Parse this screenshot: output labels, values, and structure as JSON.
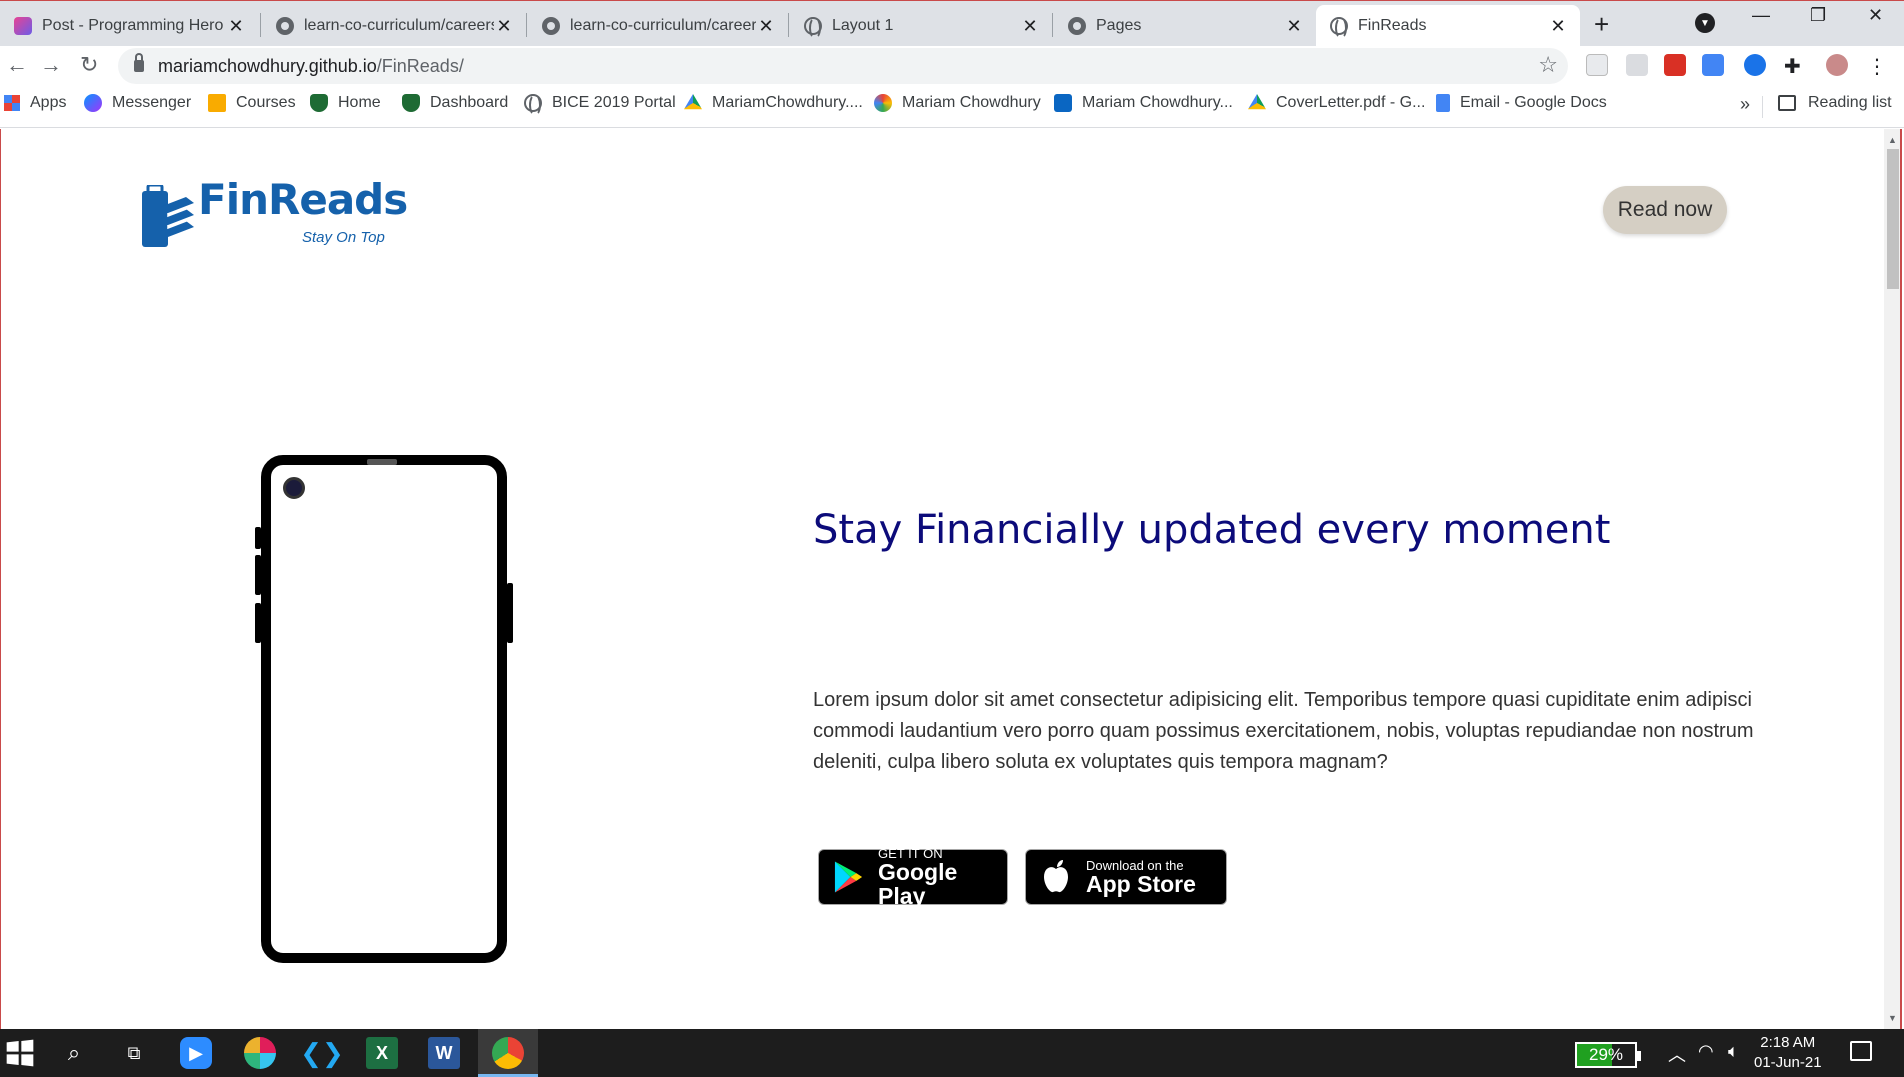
{
  "browser": {
    "tabs": [
      {
        "title": "Post - Programming Hero",
        "icon": "programming-hero-icon"
      },
      {
        "title": "learn-co-curriculum/careers",
        "icon": "github-icon"
      },
      {
        "title": "learn-co-curriculum/careers",
        "icon": "github-icon"
      },
      {
        "title": "Layout 1",
        "icon": "globe-icon"
      },
      {
        "title": "Pages",
        "icon": "github-icon"
      },
      {
        "title": "FinReads",
        "icon": "globe-icon",
        "active": true
      }
    ],
    "url_host": "mariamchowdhury.github.io",
    "url_path": "/FinReads/",
    "bookmarks": [
      {
        "label": "Apps",
        "icon": "apps-grid-icon"
      },
      {
        "label": "Messenger",
        "icon": "messenger-icon"
      },
      {
        "label": "Courses",
        "icon": "classroom-icon"
      },
      {
        "label": "Home",
        "icon": "shield-icon"
      },
      {
        "label": "Dashboard",
        "icon": "shield-icon"
      },
      {
        "label": "BICE 2019 Portal",
        "icon": "globe-icon"
      },
      {
        "label": "MariamChowdhury....",
        "icon": "google-drive-icon"
      },
      {
        "label": "Mariam Chowdhury",
        "icon": "profile-icon"
      },
      {
        "label": "Mariam Chowdhury...",
        "icon": "linkedin-icon"
      },
      {
        "label": "CoverLetter.pdf - G...",
        "icon": "google-drive-icon"
      },
      {
        "label": "Email - Google Docs",
        "icon": "google-docs-icon"
      }
    ],
    "more_bookmarks": "»",
    "reading_list": "Reading list"
  },
  "page": {
    "logo_text": "FinReads",
    "logo_tagline": "Stay On Top",
    "read_now": "Read now",
    "headline": "Stay Financially updated every moment",
    "paragraph": "Lorem ipsum dolor sit amet consectetur adipisicing elit. Temporibus tempore quasi cupiditate enim adipisci commodi laudantium vero porro quam possimus exercitationem, nobis, voluptas repudiandae non nostrum deleniti, culpa libero soluta ex voluptates quis tempora magnam?",
    "google_play": {
      "small": "GET IT ON",
      "big": "Google Play"
    },
    "app_store": {
      "small": "Download on the",
      "big": "App Store"
    }
  },
  "taskbar": {
    "battery": "29%",
    "time": "2:18 AM",
    "date": "01-Jun-21"
  },
  "colors": {
    "brand_blue": "#1561ab",
    "headline_navy": "#0c0b7a",
    "read_button_bg": "#d5cfc4"
  }
}
